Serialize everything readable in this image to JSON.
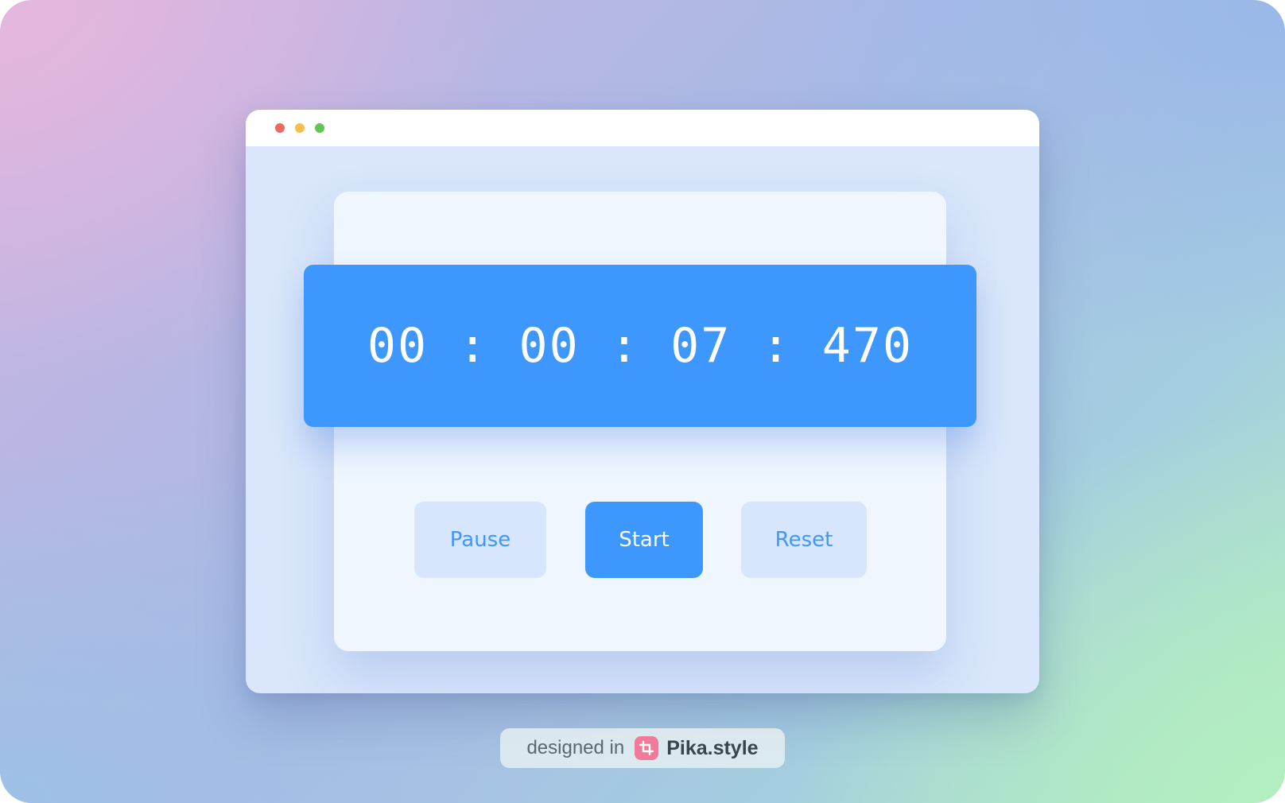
{
  "window": {
    "controls": [
      "close",
      "minimize",
      "maximize"
    ]
  },
  "stopwatch": {
    "time": "00 : 00 : 07 : 470"
  },
  "buttons": {
    "pause": "Pause",
    "start": "Start",
    "reset": "Reset"
  },
  "badge": {
    "prefix": "designed in",
    "brand": "Pika.style",
    "logo_icon": "crop-icon"
  },
  "colors": {
    "accent": "#3e97fd",
    "button_secondary_bg": "#d7e6fd",
    "card_bg": "#eff6fe",
    "window_bg": "#d9e6fb",
    "close": "#ee6a5f",
    "minimize": "#f5bf4f",
    "maximize": "#61c454",
    "logo_bg": "#f07a99"
  }
}
